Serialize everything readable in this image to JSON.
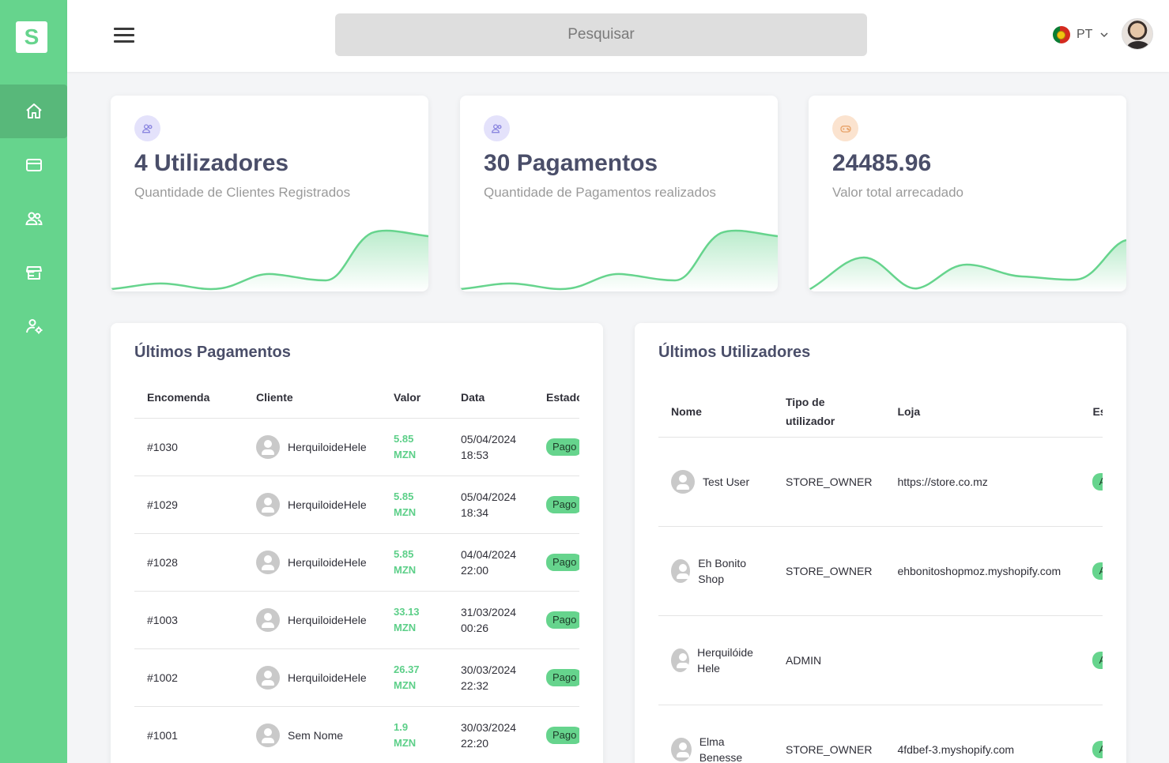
{
  "brand": {
    "logo_letter": "S",
    "accent": "#66d48d"
  },
  "sidebar": {
    "items": [
      {
        "name": "home",
        "icon": "home-icon",
        "active": true
      },
      {
        "name": "payments",
        "icon": "credit-card-icon",
        "active": false
      },
      {
        "name": "users",
        "icon": "users-icon",
        "active": false
      },
      {
        "name": "stores",
        "icon": "store-icon",
        "active": false
      },
      {
        "name": "user-settings",
        "icon": "user-gear-icon",
        "active": false
      }
    ]
  },
  "header": {
    "search_placeholder": "Pesquisar",
    "language": "PT",
    "language_flag": "portugal-flag-icon"
  },
  "stats": [
    {
      "value": "4 Utilizadores",
      "label": "Quantidade de Clientes Registrados",
      "icon": "users-icon",
      "icon_bg": "#e4e2fb",
      "icon_color": "#8b86e0"
    },
    {
      "value": "30 Pagamentos",
      "label": "Quantidade de Pagamentos realizados",
      "icon": "users-icon",
      "icon_bg": "#e4e2fb",
      "icon_color": "#8b86e0"
    },
    {
      "value": "24485.96",
      "label": "Valor total arrecadado",
      "icon": "gamepad-icon",
      "icon_bg": "#fbe3cf",
      "icon_color": "#e8a36a"
    }
  ],
  "payments": {
    "title": "Últimos Pagamentos",
    "columns": [
      "Encomenda",
      "Cliente",
      "Valor",
      "Data",
      "Estado"
    ],
    "rows": [
      {
        "order": "#1030",
        "client": "HerquiloideHele",
        "amount": "5.85",
        "currency": "MZN",
        "date": "05/04/2024",
        "time": "18:53",
        "status": "Pago"
      },
      {
        "order": "#1029",
        "client": "HerquiloideHele",
        "amount": "5.85",
        "currency": "MZN",
        "date": "05/04/2024",
        "time": "18:34",
        "status": "Pago"
      },
      {
        "order": "#1028",
        "client": "HerquiloideHele",
        "amount": "5.85",
        "currency": "MZN",
        "date": "04/04/2024",
        "time": "22:00",
        "status": "Pago"
      },
      {
        "order": "#1003",
        "client": "HerquiloideHele",
        "amount": "33.13",
        "currency": "MZN",
        "date": "31/03/2024",
        "time": "00:26",
        "status": "Pago"
      },
      {
        "order": "#1002",
        "client": "HerquiloideHele",
        "amount": "26.37",
        "currency": "MZN",
        "date": "30/03/2024",
        "time": "22:32",
        "status": "Pago"
      },
      {
        "order": "#1001",
        "client": "Sem Nome",
        "amount": "1.9",
        "currency": "MZN",
        "date": "30/03/2024",
        "time": "22:20",
        "status": "Pago"
      }
    ]
  },
  "users": {
    "title": "Últimos Utilizadores",
    "columns": [
      "Nome",
      "Tipo de utilizador",
      "Loja",
      "Estado"
    ],
    "rows": [
      {
        "name": "Test User",
        "type": "STORE_OWNER",
        "store": "https://store.co.mz",
        "status": "Activo"
      },
      {
        "name": "Eh Bonito Shop",
        "type": "STORE_OWNER",
        "store": "ehbonitoshopmoz.myshopify.com",
        "status": "Activo"
      },
      {
        "name": "Herquilóide Hele",
        "type": "ADMIN",
        "store": "",
        "status": "Activo"
      },
      {
        "name": "Elma Benesse",
        "type": "STORE_OWNER",
        "store": "4fdbef-3.myshopify.com",
        "status": "Activo"
      }
    ]
  }
}
